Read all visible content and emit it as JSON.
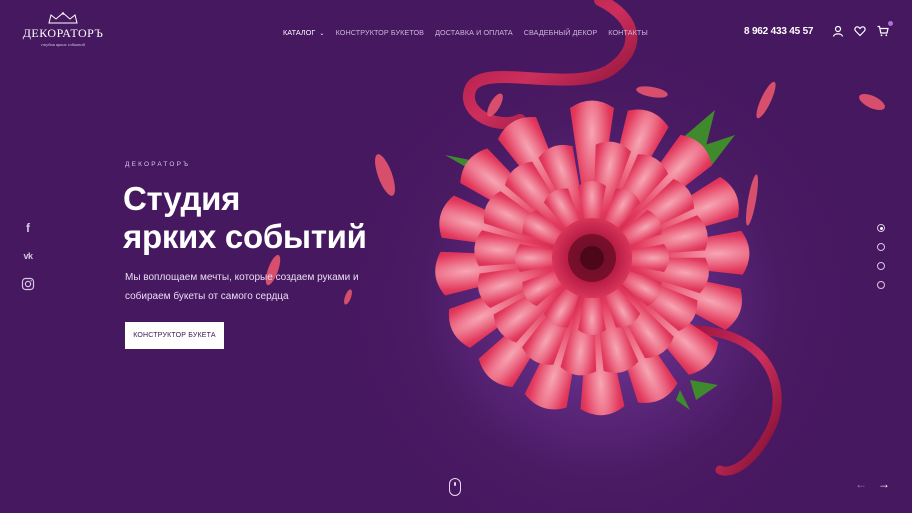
{
  "brand": {
    "name": "ДЕКОРАТОРЪ",
    "tagline": "студия ярких событий"
  },
  "nav": {
    "items": [
      {
        "label": "КАТАЛОГ",
        "active": true,
        "has_dropdown": true
      },
      {
        "label": "КОНСТРУКТОР БУКЕТОВ",
        "active": false
      },
      {
        "label": "ДОСТАВКА И ОПЛАТА",
        "active": false
      },
      {
        "label": "СВАДЕБНЫЙ ДЕКОР",
        "active": false
      },
      {
        "label": "КОНТАКТЫ",
        "active": false
      }
    ]
  },
  "header": {
    "phone": "8 962 433 45 57",
    "icons": [
      "user-icon",
      "heart-icon",
      "cart-icon"
    ]
  },
  "hero": {
    "eyebrow": "ДЕКОРАТОРЪ",
    "title_line1": "Студия",
    "title_line2": "ярких событий",
    "desc_line1": "Мы воплощаем мечты, которые создаем руками и",
    "desc_line2": "собираем букеты от самого сердца",
    "cta_label": "КОНСТРУКТОР БУКЕТА"
  },
  "social": [
    "facebook-icon",
    "vk-icon",
    "instagram-icon"
  ],
  "slider": {
    "total": 4,
    "active": 1
  },
  "colors": {
    "background": "#4a1a63",
    "accent": "#b16ee0",
    "flower": "#e0325a"
  }
}
